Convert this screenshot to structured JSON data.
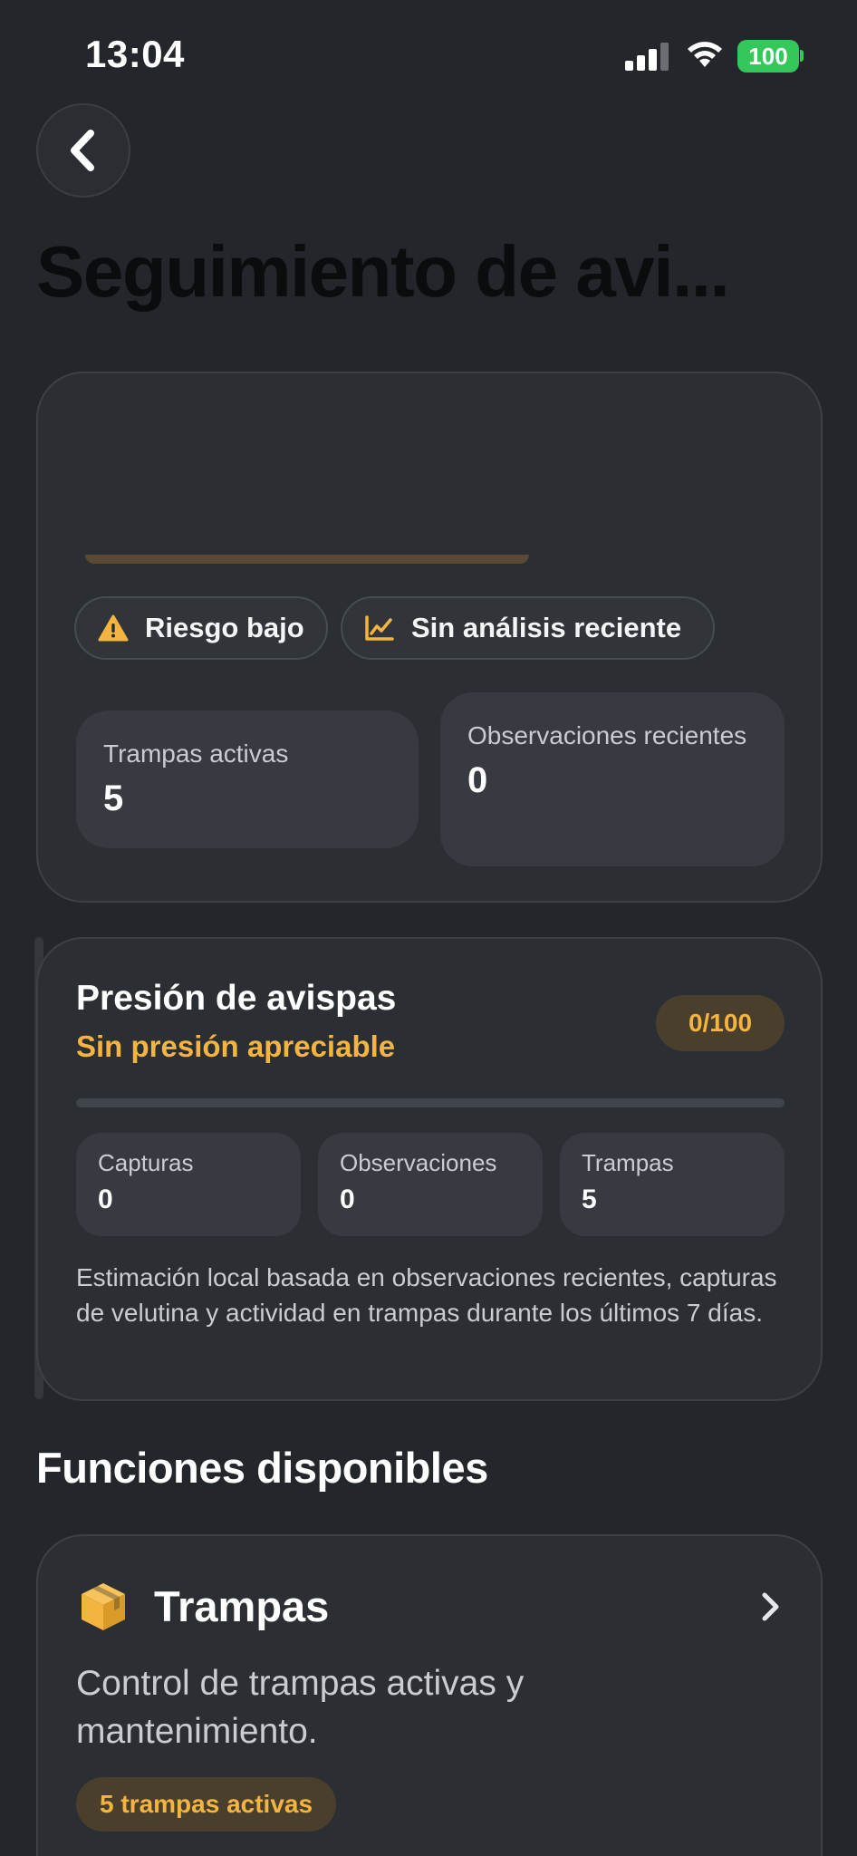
{
  "status_bar": {
    "time": "13:04",
    "battery": "100",
    "icons": [
      "signal-icon",
      "wifi-icon",
      "battery-icon"
    ]
  },
  "header": {
    "back_icon": "chevron-left-icon",
    "title": "Seguimiento de avi..."
  },
  "summary": {
    "chips": [
      {
        "icon": "warning-icon",
        "label": "Riesgo bajo"
      },
      {
        "icon": "chart-line-icon",
        "label": "Sin análisis reciente"
      }
    ],
    "stats": [
      {
        "label": "Trampas activas",
        "value": "5"
      },
      {
        "label": "Observaciones recientes",
        "value": "0"
      }
    ]
  },
  "pressure": {
    "title": "Presión de avispas",
    "status": "Sin presión apreciable",
    "score": "0/100",
    "score_value": 0,
    "tiles": [
      {
        "label": "Capturas",
        "value": "0"
      },
      {
        "label": "Observaciones",
        "value": "0"
      },
      {
        "label": "Trampas",
        "value": "5"
      }
    ],
    "note": "Estimación local basada en observaciones recientes, capturas de velutina y actividad en trampas durante los últimos 7 días."
  },
  "functions": {
    "title": "Funciones disponibles",
    "items": [
      {
        "icon": "box-icon",
        "title": "Trampas",
        "description": "Control de trampas activas y mantenimiento.",
        "badge": "5 trampas activas"
      }
    ]
  },
  "colors": {
    "background": "#23262b",
    "card": "#2b2e33",
    "accent": "#f3b53f",
    "battery": "#35c759"
  }
}
